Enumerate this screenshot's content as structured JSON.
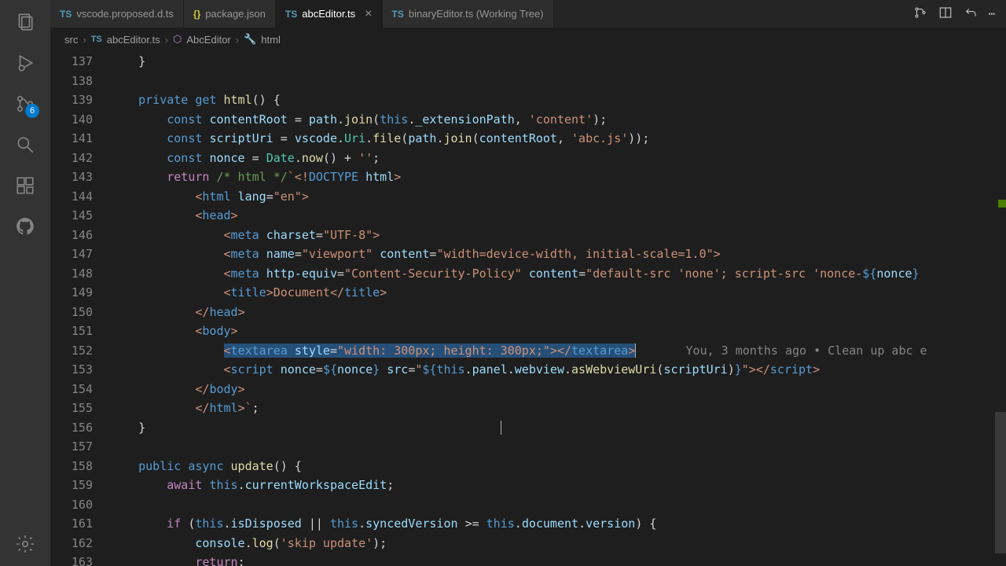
{
  "activity": {
    "scm_badge": "6"
  },
  "tabs": [
    {
      "icon": "TS",
      "label": "vscode.proposed.d.ts",
      "active": false
    },
    {
      "icon": "{}",
      "label": "package.json",
      "active": false,
      "json": true
    },
    {
      "icon": "TS",
      "label": "abcEditor.ts",
      "active": true
    },
    {
      "icon": "TS",
      "label": "binaryEditor.ts (Working Tree)",
      "active": false
    }
  ],
  "breadcrumb": {
    "folder": "src",
    "file": "abcEditor.ts",
    "class": "AbcEditor",
    "member": "html"
  },
  "lines_start": 137,
  "lines_end": 163,
  "codelens152": "You, 3 months ago • Clean up abc e",
  "code": {
    "l137": "    }",
    "l139_a": "private",
    "l139_b": "get",
    "l139_c": "html",
    "l139_d": "() {",
    "l140": "        const contentRoot = path.join(this._extensionPath, 'content');",
    "l141": "        const scriptUri = vscode.Uri.file(path.join(contentRoot, 'abc.js'));",
    "l142": "        const nonce = Date.now() + '';",
    "l143": "        return /* html */`<!DOCTYPE html>",
    "l144": "            <html lang=\"en\">",
    "l145": "            <head>",
    "l146": "                <meta charset=\"UTF-8\">",
    "l147": "                <meta name=\"viewport\" content=\"width=device-width, initial-scale=1.0\">",
    "l148": "                <meta http-equiv=\"Content-Security-Policy\" content=\"default-src 'none'; script-src 'nonce-${nonce}",
    "l149": "                <title>Document</title>",
    "l150": "            </head>",
    "l151": "            <body>",
    "l152_sel": "<textarea style=\"width: 300px; height: 300px;\"></textarea>",
    "l153": "                <script nonce=${nonce} src=\"${this.panel.webview.asWebviewUri(scriptUri)}\"></script>",
    "l154": "            </body>",
    "l155": "            </html>`;",
    "l156": "    }",
    "l158_a": "public",
    "l158_b": "async",
    "l158_c": "update",
    "l158_d": "() {",
    "l159": "        await this.currentWorkspaceEdit;",
    "l161": "        if (this.isDisposed || this.syncedVersion >= this.document.version) {",
    "l162": "            console.log('skip update');",
    "l163": "            return;"
  }
}
